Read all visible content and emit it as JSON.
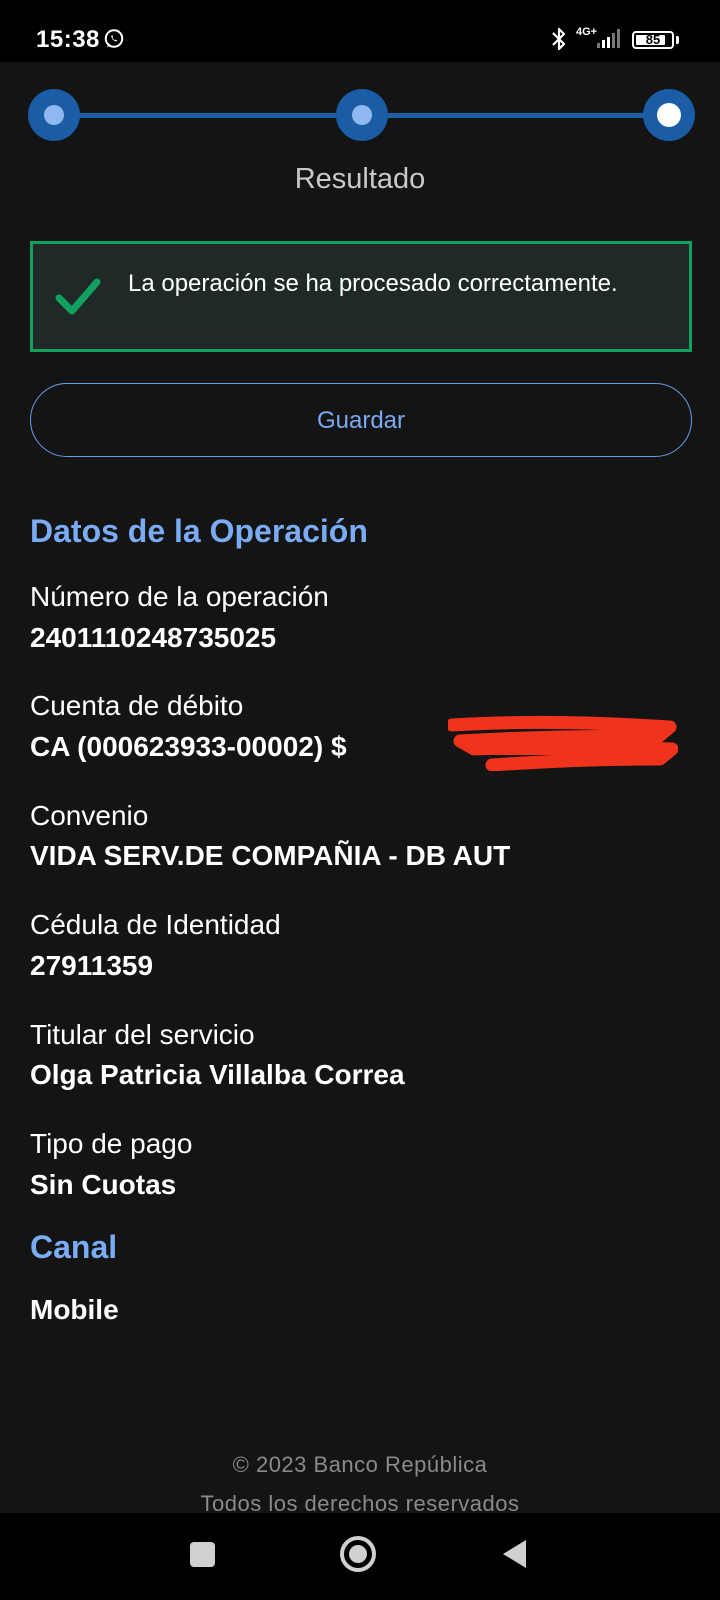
{
  "status_bar": {
    "time": "15:38",
    "network": "4G+",
    "battery": "85",
    "battery_level": 0.85,
    "icons": [
      "whatsapp-icon",
      "bluetooth-icon",
      "signal-icon",
      "battery-icon"
    ]
  },
  "stepper": {
    "steps_total": 3,
    "current_step": 3,
    "current_title": "Resultado"
  },
  "alert": {
    "message": "La operación se ha procesado correctamente.",
    "icon": "check-icon",
    "color": "#13a05e"
  },
  "save_button": {
    "label": "Guardar"
  },
  "details": {
    "section_title": "Datos de la Operación",
    "fields": [
      {
        "label": "Número de la operación",
        "value": "2401110248735025"
      },
      {
        "label": "Cuenta de débito",
        "value": "CA (000623933-00002) $"
      },
      {
        "label": "Convenio",
        "value": "VIDA SERV.DE COMPAÑIA - DB AUT"
      },
      {
        "label": "Cédula de Identidad",
        "value": "27911359"
      },
      {
        "label": "Titular del servicio",
        "value": "Olga Patricia Villalba Correa"
      },
      {
        "label": "Tipo de pago",
        "value": "Sin Cuotas"
      }
    ]
  },
  "channel": {
    "section_title": "Canal",
    "value": "Mobile"
  },
  "footer": {
    "copyright": "© 2023 Banco República",
    "rights": "Todos los derechos reservados"
  },
  "colors": {
    "background": "#141414",
    "accent": "#7aabf5",
    "success": "#13a05e",
    "step": "#1a5da6"
  }
}
